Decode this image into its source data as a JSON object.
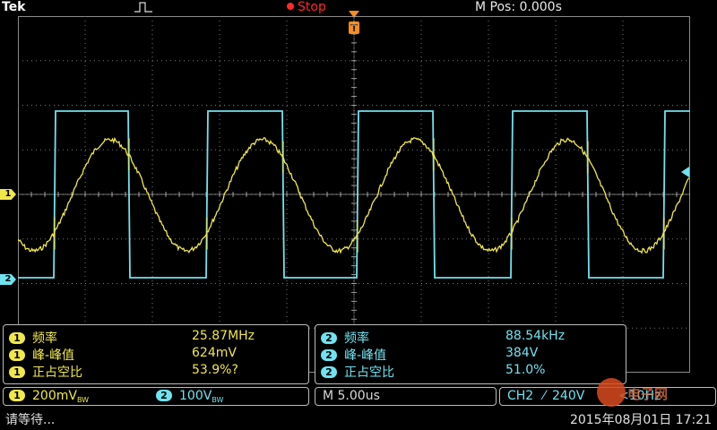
{
  "header": {
    "brand": "Tek",
    "run_state": "Stop",
    "position": "M Pos: 0.000s",
    "trigger_position_marker": "T"
  },
  "channel_markers": {
    "ch1": "1",
    "ch2": "2"
  },
  "measurements": {
    "ch1": [
      {
        "channel": "1",
        "label": "频率",
        "value": "25.87MHz"
      },
      {
        "channel": "1",
        "label": "峰-峰值",
        "value": "624mV"
      },
      {
        "channel": "1",
        "label": "正占空比",
        "value": "53.9%?"
      }
    ],
    "ch2": [
      {
        "channel": "2",
        "label": "频率",
        "value": "88.54kHz"
      },
      {
        "channel": "2",
        "label": "峰-峰值",
        "value": "384V"
      },
      {
        "channel": "2",
        "label": "正占空比",
        "value": "51.0%"
      }
    ]
  },
  "vertical": {
    "ch1": {
      "badge": "1",
      "scale": "200mV",
      "suffix": "BW"
    },
    "ch2": {
      "badge": "2",
      "scale": "100V",
      "suffix": "BW"
    }
  },
  "timebase": "M 5.00us",
  "trigger": {
    "source": "CH2",
    "slope": "⁄",
    "level": "240V",
    "rate": "<10Hz"
  },
  "status": {
    "message": "请等待...",
    "datetime": "2015年08月01日 17:21"
  },
  "colors": {
    "ch1": "#f0e84a",
    "ch2": "#6fe3ef",
    "run_state": "#ff2a2a",
    "trigger_marker": "#ff8c1a"
  },
  "watermark": {
    "text": "电子网"
  }
}
